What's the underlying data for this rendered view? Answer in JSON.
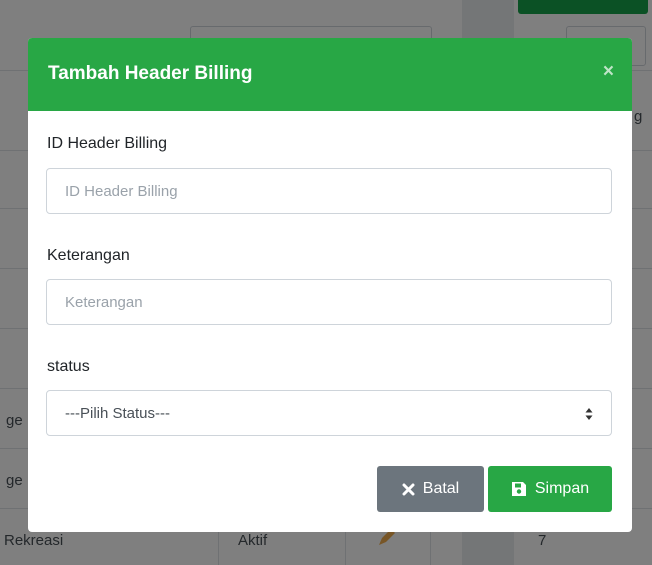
{
  "background": {
    "row_texts": [
      "ge",
      "ge",
      "Rekreasi"
    ],
    "status_text": "Aktif",
    "number_text": "7",
    "col_letter": "g"
  },
  "modal": {
    "title": "Tambah Header Billing",
    "close_symbol": "×",
    "fields": {
      "id_header": {
        "label": "ID Header Billing",
        "placeholder": "ID Header Billing",
        "value": ""
      },
      "keterangan": {
        "label": "Keterangan",
        "placeholder": "Keterangan",
        "value": ""
      },
      "status": {
        "label": "status",
        "selected": "---Pilih Status---"
      }
    },
    "buttons": {
      "batal": "Batal",
      "simpan": "Simpan"
    }
  },
  "colors": {
    "header_green": "#28a745",
    "batal_gray": "#6c757d"
  },
  "icons": {
    "close": "close-icon",
    "batal": "x-icon",
    "simpan": "save-icon",
    "select_arrow": "sort-arrows-icon"
  }
}
